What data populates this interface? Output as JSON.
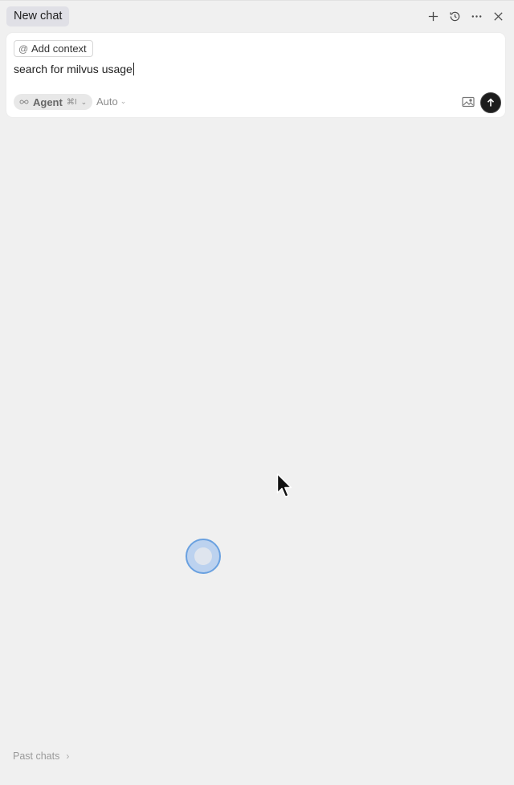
{
  "header": {
    "tab_label": "New chat",
    "icons": [
      "plus-icon",
      "history-icon",
      "more-icon",
      "close-icon"
    ]
  },
  "composer": {
    "context_label": "Add context",
    "input_value": "search for milvus usage",
    "mode": {
      "label": "Agent",
      "shortcut": "⌘I"
    },
    "model": {
      "label": "Auto"
    }
  },
  "footer": {
    "past_chats_label": "Past chats"
  },
  "colors": {
    "background": "#f0f0f0",
    "send_button": "#1d1d1d",
    "click_ring": "#6aa1e0"
  }
}
